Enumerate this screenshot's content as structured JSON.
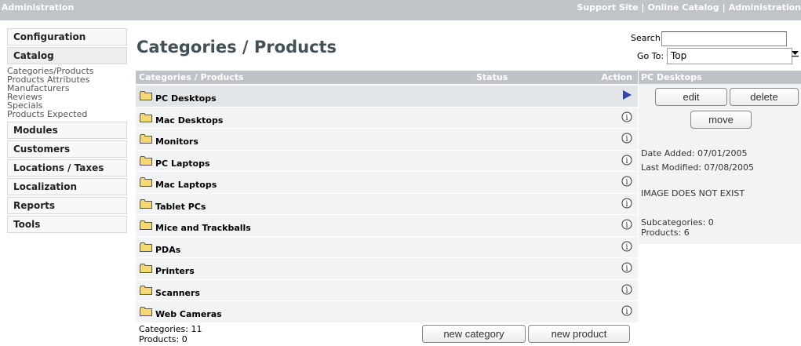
{
  "topbar": {
    "title": "Administration",
    "links": [
      "Support Site",
      "Online Catalog",
      "Administration"
    ],
    "separator": "|"
  },
  "sidebar": {
    "sections": [
      {
        "label": "Configuration"
      },
      {
        "label": "Catalog",
        "items": [
          "Categories/Products",
          "Products Attributes",
          "Manufacturers",
          "Reviews",
          "Specials",
          "Products Expected"
        ]
      },
      {
        "label": "Modules"
      },
      {
        "label": "Customers"
      },
      {
        "label": "Locations / Taxes"
      },
      {
        "label": "Localization"
      },
      {
        "label": "Reports"
      },
      {
        "label": "Tools"
      }
    ]
  },
  "main": {
    "title": "Categories / Products",
    "search_label": "Search:",
    "search_value": "",
    "goto_label": "Go To:",
    "goto_value": "Top",
    "table": {
      "headers": [
        "Categories / Products",
        "Status",
        "Action"
      ],
      "rows": [
        {
          "name": "PC Desktops",
          "selected": true
        },
        {
          "name": "Mac Desktops",
          "selected": false
        },
        {
          "name": "Monitors",
          "selected": false
        },
        {
          "name": "PC Laptops",
          "selected": false
        },
        {
          "name": "Mac Laptops",
          "selected": false
        },
        {
          "name": "Tablet PCs",
          "selected": false
        },
        {
          "name": "Mice and Trackballs",
          "selected": false
        },
        {
          "name": "PDAs",
          "selected": false
        },
        {
          "name": "Printers",
          "selected": false
        },
        {
          "name": "Scanners",
          "selected": false
        },
        {
          "name": "Web Cameras",
          "selected": false
        }
      ]
    },
    "counts": {
      "categories": "Categories: 11",
      "products": "Products: 0"
    },
    "buttons": {
      "new_category": "new category",
      "new_product": "new product"
    }
  },
  "panel": {
    "title": "PC Desktops",
    "edit": "edit",
    "delete": "delete",
    "move": "move",
    "date_added": "Date Added: 07/01/2005",
    "last_modified": "Last Modified: 07/08/2005",
    "image_note": "IMAGE DOES NOT EXIST",
    "subcategories": "Subcategories: 0",
    "products": "Products: 6"
  },
  "colors": {
    "header_bg": "#bfc3c7",
    "row_bg": "#f1f3f4",
    "selected_row_bg": "#e2e5e8",
    "title_color": "#445058",
    "folder_fill": "#f5d870",
    "arrow_color": "#3344aa"
  },
  "icons": {
    "folder": "folder-icon",
    "selected_action": "arrow-right-icon",
    "row_action": "info-icon"
  }
}
